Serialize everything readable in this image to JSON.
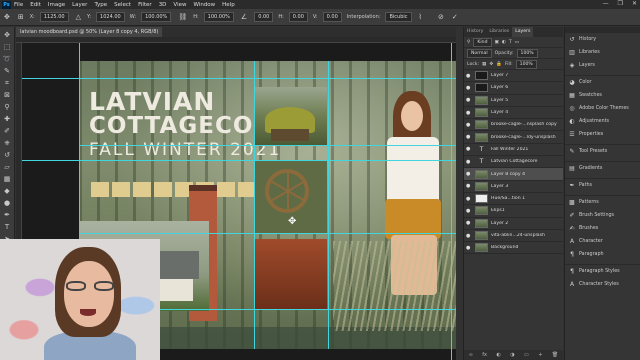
{
  "app": {
    "logo": "Ps",
    "menus": [
      "File",
      "Edit",
      "Image",
      "Layer",
      "Type",
      "Select",
      "Filter",
      "3D",
      "View",
      "Window",
      "Help"
    ],
    "window_controls": [
      "—",
      "❐",
      "✕"
    ]
  },
  "options_bar": {
    "x_label": "X:",
    "x_value": "1125.00",
    "y_label": "Y:",
    "y_value": "1024.00",
    "w_label": "W:",
    "w_value": "100.00%",
    "h_label": "H:",
    "h_value": "100.00%",
    "angle_value": "0.00",
    "h_skew_label": "H:",
    "h_skew_value": "0.00",
    "v_skew_label": "V:",
    "v_skew_value": "0.00",
    "interpolation_label": "Interpolation:",
    "interpolation_value": "Bicubic"
  },
  "document": {
    "tab_title": "latvian moodboard.psd @ 50% (Layer 8 copy 4, RGB/8)"
  },
  "moodboard": {
    "title_line1": "LATVIAN",
    "title_line2": "COTTAGECORE",
    "title_line3": "FALL WINTER 2021",
    "swatch_count": 8,
    "swatch_color": "#e0cc8e"
  },
  "layers_panel": {
    "tabs": [
      "History",
      "Libraries",
      "Layers"
    ],
    "active_tab": "Layers",
    "filter_value": "Kind",
    "blend_mode": "Normal",
    "opacity_label": "Opacity:",
    "opacity_value": "100%",
    "lock_label": "Lock:",
    "fill_label": "Fill:",
    "fill_value": "100%",
    "layers": [
      {
        "name": "Layer 7",
        "thumb": "dark",
        "selected": false
      },
      {
        "name": "Layer 6",
        "thumb": "dark",
        "selected": false
      },
      {
        "name": "Layer 5",
        "thumb": "photo",
        "selected": false
      },
      {
        "name": "Layer 4",
        "thumb": "photo",
        "selected": false
      },
      {
        "name": "brooke-cagle-...nsplash copy",
        "thumb": "photo",
        "selected": false
      },
      {
        "name": "brooke-cagle-...ldy-unsplash",
        "thumb": "photo",
        "selected": false
      },
      {
        "name": "Fall Winter 2021",
        "thumb": "text",
        "selected": false
      },
      {
        "name": "Latvian Cottagecore",
        "thumb": "text",
        "selected": false
      },
      {
        "name": "Layer 8 copy 4",
        "thumb": "photo",
        "selected": true
      },
      {
        "name": "Layer 3",
        "thumb": "photo",
        "selected": false
      },
      {
        "name": "Hue/Sa...tion 1",
        "thumb": "white",
        "selected": false
      },
      {
        "name": "Elips1",
        "thumb": "photo",
        "selected": false
      },
      {
        "name": "Layer 2",
        "thumb": "photo",
        "selected": false
      },
      {
        "name": "vita-ablin...24-unsplash",
        "thumb": "photo",
        "selected": false
      },
      {
        "name": "Background",
        "thumb": "photo",
        "selected": false
      }
    ],
    "bottom_icons": [
      "∞",
      "fx",
      "◐",
      "◑",
      "▭",
      "+",
      "🗑"
    ]
  },
  "dock": {
    "items": [
      {
        "label": "History",
        "icon": "history-icon"
      },
      {
        "label": "Libraries",
        "icon": "libraries-icon"
      },
      {
        "label": "Layers",
        "icon": "layers-icon"
      },
      {
        "label": "Color",
        "icon": "color-icon"
      },
      {
        "label": "Swatches",
        "icon": "swatches-icon"
      },
      {
        "label": "Adobe Color Themes",
        "icon": "color-themes-icon"
      },
      {
        "label": "Adjustments",
        "icon": "adjustments-icon"
      },
      {
        "label": "Properties",
        "icon": "properties-icon"
      },
      {
        "label": "Tool Presets",
        "icon": "tool-presets-icon"
      },
      {
        "label": "Gradients",
        "icon": "gradients-icon"
      },
      {
        "label": "Paths",
        "icon": "paths-icon"
      },
      {
        "label": "Patterns",
        "icon": "patterns-icon"
      },
      {
        "label": "Brush Settings",
        "icon": "brush-settings-icon"
      },
      {
        "label": "Brushes",
        "icon": "brushes-icon"
      },
      {
        "label": "Character",
        "icon": "character-icon"
      },
      {
        "label": "Paragraph",
        "icon": "paragraph-icon"
      },
      {
        "label": "Paragraph Styles",
        "icon": "paragraph-styles-icon"
      },
      {
        "label": "Character Styles",
        "icon": "character-styles-icon"
      }
    ]
  }
}
